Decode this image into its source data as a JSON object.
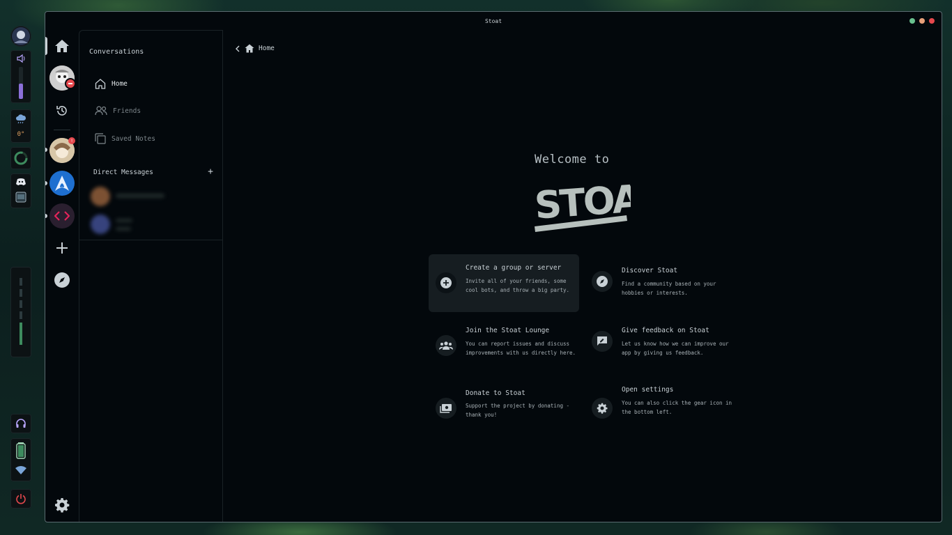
{
  "window": {
    "title": "Stoat"
  },
  "dock": {
    "weather_temp": "0°"
  },
  "sidebar": {
    "title": "Conversations",
    "items": [
      {
        "label": "Home",
        "active": true
      },
      {
        "label": "Friends",
        "active": false
      },
      {
        "label": "Saved Notes",
        "active": false
      }
    ],
    "dm_header": "Direct Messages",
    "dm_add": "+"
  },
  "breadcrumb": {
    "label": "Home"
  },
  "main": {
    "welcome": "Welcome to",
    "logo_text": "STOAT",
    "cards": [
      {
        "title": "Create a group or server",
        "desc": "Invite all of your friends, some cool bots, and throw a big party.",
        "icon": "plus-circle-icon"
      },
      {
        "title": "Discover Stoat",
        "desc": "Find a community based on your hobbies or interests.",
        "icon": "compass-icon"
      },
      {
        "title": "Join the Stoat Lounge",
        "desc": "You can report issues and discuss improvements with us directly here.",
        "icon": "group-icon"
      },
      {
        "title": "Give feedback on Stoat",
        "desc": "Let us know how we can improve our app by giving us feedback.",
        "icon": "feedback-icon"
      },
      {
        "title": "Donate to Stoat",
        "desc": "Support the project by donating - thank you!",
        "icon": "donate-icon"
      },
      {
        "title": "Open settings",
        "desc": "You can also click the gear icon in the bottom left.",
        "icon": "gear-icon"
      }
    ]
  },
  "colors": {
    "accent_red": "#e5484d",
    "accent_purple": "#8b6fd8",
    "accent_green": "#3d8b5e",
    "window_bg": "#03080c"
  }
}
